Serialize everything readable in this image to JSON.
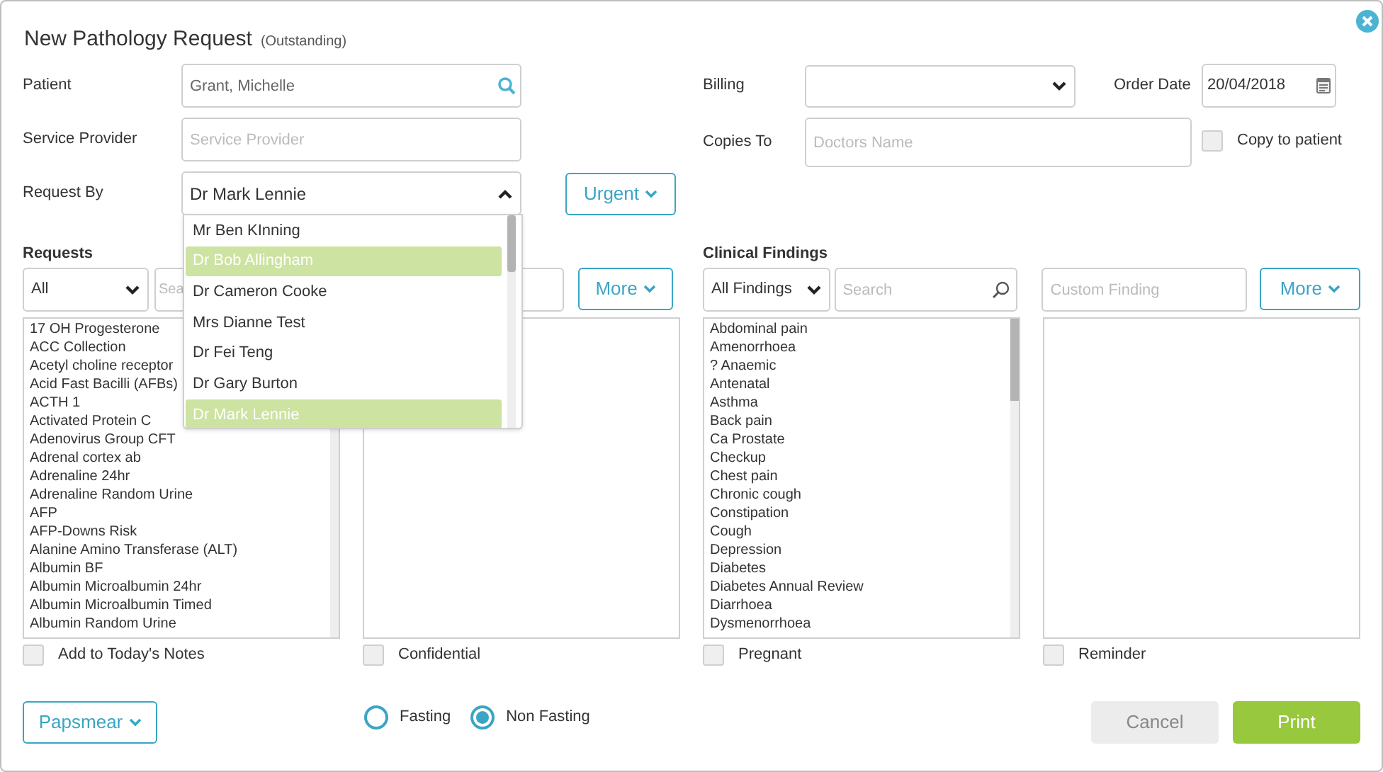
{
  "dialog": {
    "title": "New Pathology Request",
    "status": "(Outstanding)"
  },
  "form": {
    "patient": {
      "label": "Patient",
      "value": "Grant, Michelle"
    },
    "service_provider": {
      "label": "Service Provider",
      "placeholder": "Service Provider"
    },
    "request_by": {
      "label": "Request By",
      "value": "Dr Mark Lennie",
      "expanded": true,
      "options": [
        {
          "label": "Mr Ben KInning",
          "highlighted": false
        },
        {
          "label": "Dr Bob Allingham",
          "highlighted": true
        },
        {
          "label": "Dr Cameron Cooke",
          "highlighted": false
        },
        {
          "label": "Mrs Dianne Test",
          "highlighted": false
        },
        {
          "label": "Dr Fei Teng",
          "highlighted": false
        },
        {
          "label": "Dr Gary Burton",
          "highlighted": false
        },
        {
          "label": "Dr Mark Lennie",
          "highlighted": true
        }
      ]
    },
    "urgency_button": "Urgent",
    "billing": {
      "label": "Billing"
    },
    "order_date": {
      "label": "Order Date",
      "value": "20/04/2018"
    },
    "copies_to": {
      "label": "Copies To",
      "placeholder": "Doctors Name"
    },
    "copy_to_patient": {
      "label": "Copy to patient",
      "checked": false
    }
  },
  "requests": {
    "heading": "Requests",
    "filter": "All",
    "search_placeholder": "Sea",
    "more_button": "More",
    "items": [
      "17 OH Progesterone",
      "ACC Collection",
      "Acetyl choline receptor",
      "Acid Fast Bacilli (AFBs)",
      "ACTH 1",
      "Activated Protein C",
      "Adenovirus Group CFT",
      "Adrenal cortex ab",
      "Adrenaline 24hr",
      "Adrenaline Random Urine",
      "AFP",
      "AFP-Downs Risk",
      "Alanine Amino Transferase (ALT)",
      "Albumin BF",
      "Albumin Microalbumin 24hr",
      "Albumin Microalbumin Timed",
      "Albumin Random Urine"
    ],
    "add_to_notes": {
      "label": "Add to Today's Notes",
      "checked": false
    },
    "confidential": {
      "label": "Confidential",
      "checked": false
    }
  },
  "clinical_findings": {
    "heading": "Clinical Findings",
    "filter": "All Findings",
    "search_placeholder": "Search",
    "custom_placeholder": "Custom Finding",
    "more_button": "More",
    "items": [
      "Abdominal pain",
      "Amenorrhoea",
      "? Anaemic",
      "Antenatal",
      "Asthma",
      "Back pain",
      "Ca Prostate",
      "Checkup",
      "Chest pain",
      "Chronic cough",
      "Constipation",
      "Cough",
      "Depression",
      "Diabetes",
      "Diabetes Annual Review",
      "Diarrhoea",
      "Dysmenorrhoea"
    ],
    "pregnant": {
      "label": "Pregnant",
      "checked": false
    },
    "reminder": {
      "label": "Reminder",
      "checked": false
    }
  },
  "footer": {
    "papsmear_button": "Papsmear",
    "fasting_options": [
      {
        "label": "Fasting",
        "selected": false
      },
      {
        "label": "Non Fasting",
        "selected": true
      }
    ],
    "cancel_button": "Cancel",
    "print_button": "Print"
  }
}
